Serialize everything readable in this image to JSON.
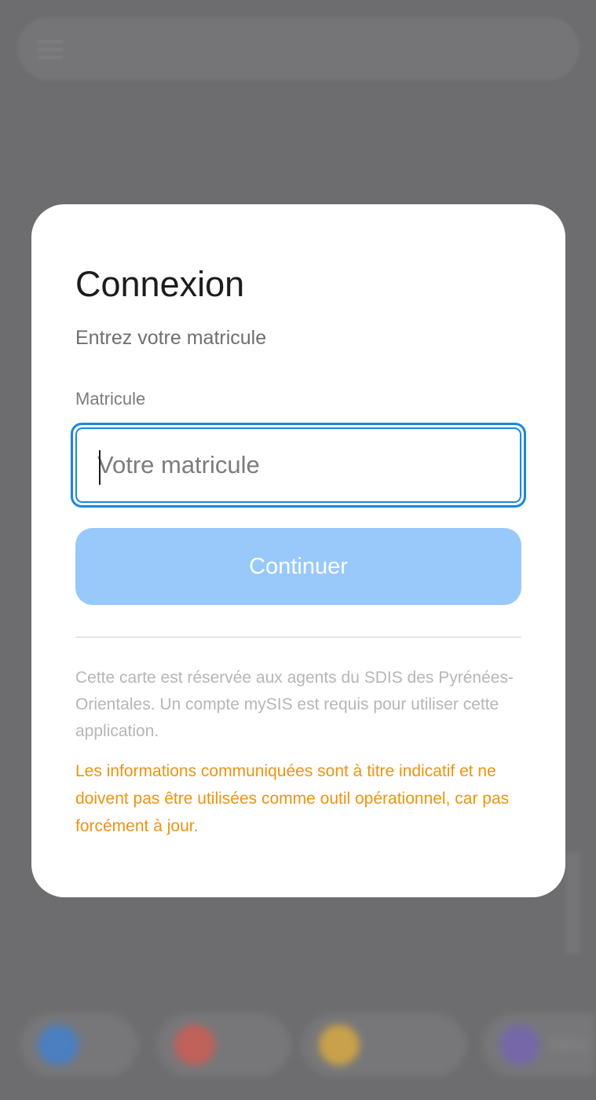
{
  "login": {
    "title": "Connexion",
    "subtitle": "Entrez votre matricule",
    "field_label": "Matricule",
    "input_placeholder": "Votre matricule",
    "input_value": "",
    "continue_label": "Continuer",
    "info": "Cette carte est réservée aux agents du SDIS des Pyrénées-Orientales. Un compte mySIS est requis pour utiliser cette application.",
    "warning": "Les informations communiquées sont à titre indicatif et ne doivent pas être utilisées comme outil opérationnel, car pas forcément à jour."
  },
  "background": {
    "chips": [
      {
        "label": "",
        "color": "#4a7fc0"
      },
      {
        "label": "",
        "color": "#c0615a"
      },
      {
        "label": "",
        "color": "#c9a14a"
      },
      {
        "label": "Aéro",
        "color": "#7668a8"
      }
    ]
  },
  "colors": {
    "accent": "#1a86e0",
    "button_disabled": "#99c9fb",
    "warning": "#ee9310"
  }
}
